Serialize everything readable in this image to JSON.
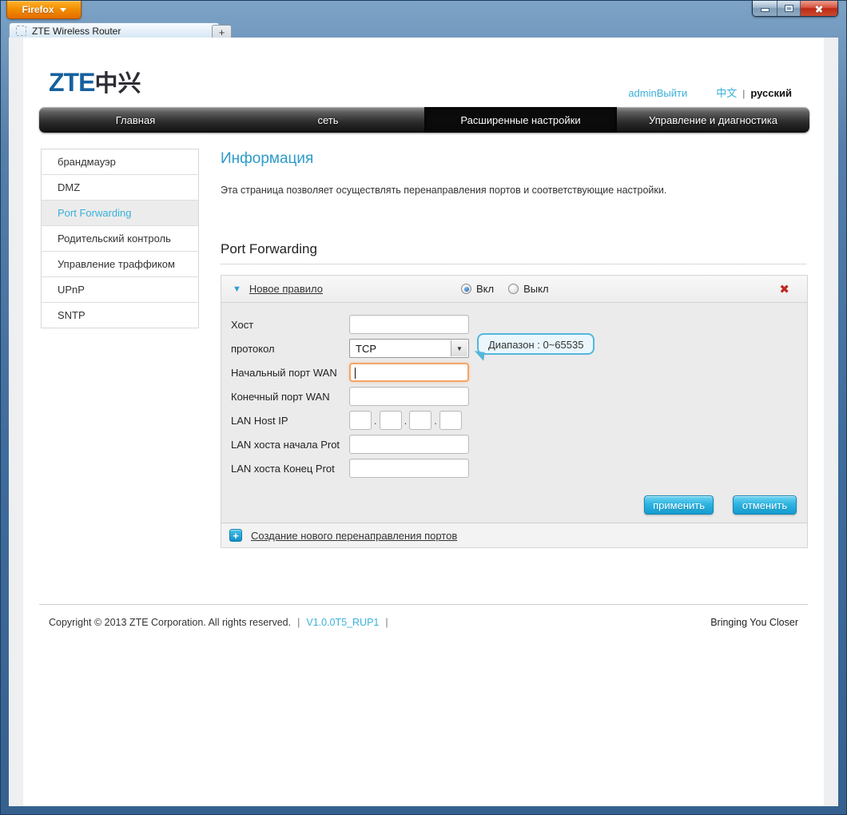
{
  "browser": {
    "menu_button": "Firefox",
    "tab_title": "ZTE Wireless Router",
    "new_tab_label": "+"
  },
  "header": {
    "logo_text": "ZTE",
    "logo_cjk": "中兴",
    "account_link": "adminВыйти",
    "lang_zh": "中文",
    "lang_divider": "|",
    "lang_ru": "русский"
  },
  "nav": {
    "tabs": [
      {
        "label": "Главная",
        "active": false
      },
      {
        "label": "сеть",
        "active": false
      },
      {
        "label": "Расширенные настройки",
        "active": true
      },
      {
        "label": "Управление и диагностика",
        "active": false
      }
    ]
  },
  "sidebar": {
    "items": [
      {
        "label": "брандмауэр",
        "active": false
      },
      {
        "label": "DMZ",
        "active": false
      },
      {
        "label": "Port Forwarding",
        "active": true
      },
      {
        "label": "Родительский контроль",
        "active": false
      },
      {
        "label": "Управление траффиком",
        "active": false
      },
      {
        "label": "UPnP",
        "active": false
      },
      {
        "label": "SNTP",
        "active": false
      }
    ]
  },
  "content": {
    "page_title": "Информация",
    "description": "Эта страница позволяет осуществлять перенаправления портов и соответствующие настройки.",
    "section_title": "Port Forwarding",
    "rule": {
      "title": "Новое правило",
      "enable_label": "Вкл",
      "disable_label": "Выкл",
      "enabled_option": "Вкл",
      "host_label": "Хост",
      "protocol_label": "протокол",
      "protocol_value": "TCP",
      "wan_start_label": "Начальный порт WAN",
      "wan_end_label": "Конечный порт WAN",
      "lan_ip_label": "LAN Host IP",
      "ip_separator": ".",
      "lan_start_label": "LAN хоста начала Prot",
      "lan_end_label": "LAN хоста Конец Prot",
      "tooltip": "Диапазон : 0~65535",
      "apply_label": "применить",
      "cancel_label": "отменить"
    },
    "add_rule_link": "Создание нового перенаправления портов"
  },
  "footer": {
    "copyright": "Copyright © 2013 ZTE Corporation. All rights reserved.",
    "divider1": "|",
    "version": "V1.0.0T5_RUP1",
    "divider2": "|",
    "slogan": "Bringing You Closer"
  },
  "icons": {
    "collapse": "▼",
    "dropdown": "▼",
    "delete": "✖",
    "add": "+"
  },
  "colors": {
    "accent_link": "#3ab0d9",
    "heading_blue": "#2e9bcb",
    "logo_blue": "#15609f",
    "button_top": "#70d5f2",
    "button_bottom": "#149ccf",
    "focus_border": "#f5a465",
    "delete_red": "#c0281e",
    "nav_dark": "#0b0b0b"
  }
}
